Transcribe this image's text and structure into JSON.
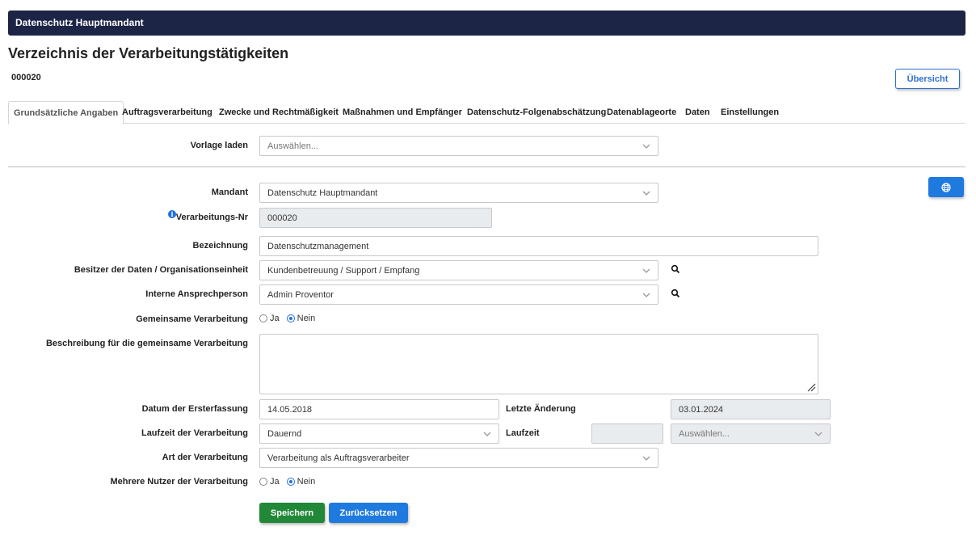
{
  "header": {
    "title": "Datenschutz Hauptmandant"
  },
  "page": {
    "title": "Verzeichnis der Verarbeitungstätigkeiten",
    "record_id": "000020",
    "overview_button": "Übersicht"
  },
  "tabs": [
    {
      "label": "Grundsätzliche Angaben",
      "active": true
    },
    {
      "label": "Auftragsverarbeitung"
    },
    {
      "label": "Zwecke und Rechtmäßigkeit"
    },
    {
      "label": "Maßnahmen und Empfänger"
    },
    {
      "label": "Datenschutz-Folgenabschätzung"
    },
    {
      "label": "Datenablageorte"
    },
    {
      "label": "Daten"
    },
    {
      "label": "Einstellungen"
    }
  ],
  "template": {
    "label": "Vorlage laden",
    "placeholder": "Auswählen..."
  },
  "form": {
    "mandant": {
      "label": "Mandant",
      "value": "Datenschutz Hauptmandant"
    },
    "processing_no": {
      "label": "Verarbeitungs-Nr",
      "value": "000020"
    },
    "designation": {
      "label": "Bezeichnung",
      "value": "Datenschutzmanagement"
    },
    "data_owner": {
      "label": "Besitzer der Daten / Organisationseinheit",
      "value": "Kundenbetreuung / Support / Empfang"
    },
    "contact": {
      "label": "Interne Ansprechperson",
      "value": "Admin Proventor"
    },
    "joint_processing": {
      "label": "Gemeinsame Verarbeitung",
      "options": [
        "Ja",
        "Nein"
      ],
      "selected": "Nein"
    },
    "joint_description": {
      "label": "Beschreibung für die gemeinsame Verarbeitung",
      "value": ""
    },
    "first_recorded": {
      "label": "Datum der Ersterfassung",
      "value": "14.05.2018"
    },
    "last_change": {
      "label": "Letzte Änderung",
      "value": "03.01.2024"
    },
    "duration": {
      "label": "Laufzeit der Verarbeitung",
      "value": "Dauernd"
    },
    "term": {
      "label": "Laufzeit",
      "value": "",
      "unit_placeholder": "Auswählen..."
    },
    "processing_type": {
      "label": "Art der Verarbeitung",
      "value": "Verarbeitung als Auftragsverarbeiter"
    },
    "multiple_users": {
      "label": "Mehrere Nutzer der Verarbeitung",
      "options": [
        "Ja",
        "Nein"
      ],
      "selected": "Nein"
    }
  },
  "actions": {
    "save": "Speichern",
    "reset": "Zurücksetzen"
  },
  "colors": {
    "header_bg": "#1d2547",
    "primary": "#1f7ae0",
    "success": "#218838"
  },
  "icons": {
    "globe": "globe-icon",
    "search": "search-icon",
    "info": "info-icon",
    "chevron": "chevron-down-icon"
  }
}
